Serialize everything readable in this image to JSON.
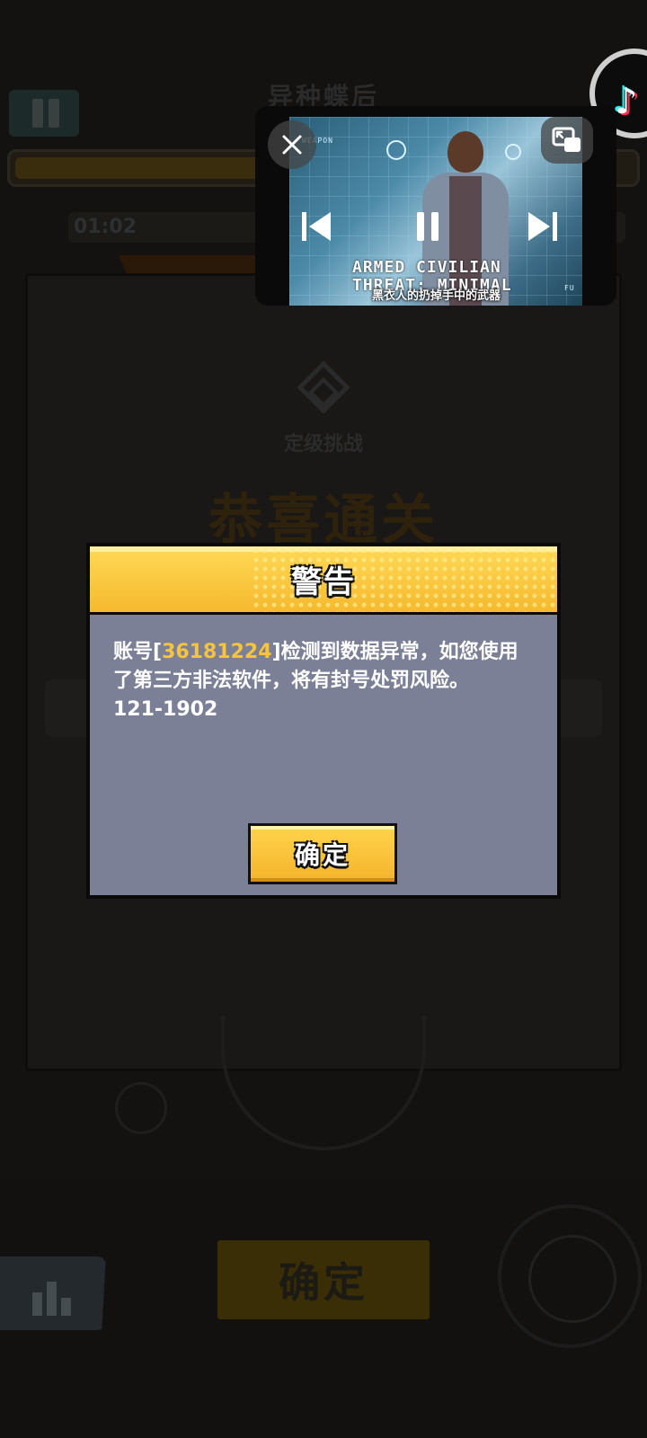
{
  "game": {
    "title": "异种蝶后",
    "timer": "01:02",
    "challenge_label": "定级挑战",
    "congrats": "恭喜通关",
    "bottom_confirm": "确定"
  },
  "dialog": {
    "title": "警告",
    "message_prefix": "账号[",
    "account_id": "36181224",
    "message_suffix": "]检测到数据异常，如您使用了第三方非法软件，将有封号处罚风险。",
    "code": "121-1902",
    "confirm_label": "确定"
  },
  "pip": {
    "overlay_text_line1": "ARMED CIVILIAN",
    "overlay_text_line2": "THREAT: MINIMAL",
    "subtitle": "黑衣人的扔掉手中的武器",
    "hud_label_weapon": "WEAPON",
    "hud_label_fu": "FU",
    "controls": [
      "close-icon",
      "expand-icon",
      "previous-icon",
      "pause-icon",
      "next-icon"
    ]
  },
  "colors": {
    "dialog_header": "#f5b92e",
    "dialog_body": "#7b8097",
    "account_highlight": "#f7c43a"
  }
}
